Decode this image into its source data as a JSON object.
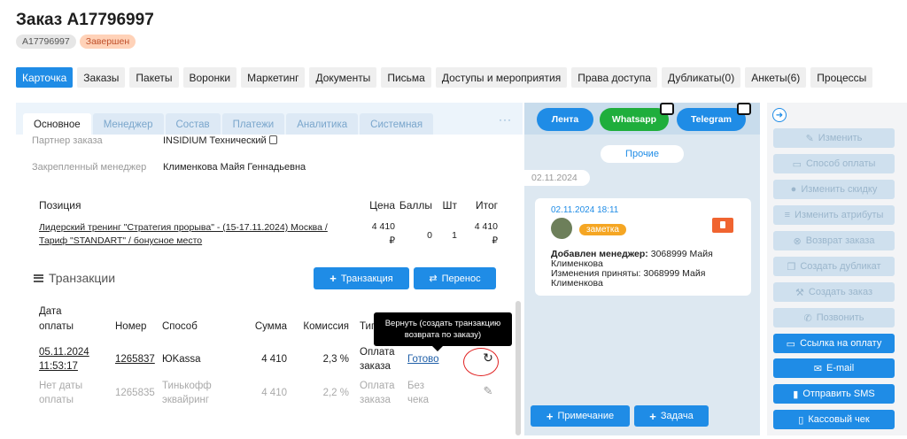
{
  "order": {
    "title": "Заказ A17796997",
    "id_badge": "A17796997",
    "status_badge": "Завершен"
  },
  "main_tabs": [
    "Карточка",
    "Заказы",
    "Пакеты",
    "Воронки",
    "Маркетинг",
    "Документы",
    "Письма",
    "Доступы и мероприятия",
    "Права доступа",
    "Дубликаты(0)",
    "Анкеты(6)",
    "Процессы"
  ],
  "sub_tabs": [
    "Основное",
    "Менеджер",
    "Состав",
    "Платежи",
    "Аналитика",
    "Системная"
  ],
  "sub_tabs_more": "···",
  "info": {
    "partner_label": "Партнер заказа",
    "partner_value": "INSIDIUM Технический",
    "manager_label": "Закрепленный менеджер",
    "manager_value": "Клименкова Майя Геннадьевна"
  },
  "positions": {
    "headers": {
      "name": "Позиция",
      "price": "Цена",
      "points": "Баллы",
      "qty": "Шт",
      "total": "Итог"
    },
    "rows": [
      {
        "name_line1": "Лидерский тренинг \"Стратегия прорыва\" - (15-17.11.2024) Москва /",
        "name_line2": "Тариф \"STANDART\" / бонусное место",
        "price_1": "4 410",
        "price_2": "₽",
        "points": "0",
        "qty": "1",
        "total_1": "4 410",
        "total_2": "₽"
      }
    ]
  },
  "transactions": {
    "title": "Транзакции",
    "add_button": "Транзакция",
    "transfer_button": "Перенос",
    "headers": {
      "date_1": "Дата",
      "date_2": "оплаты",
      "number": "Номер",
      "method": "Способ",
      "sum": "Сумма",
      "fee": "Комиссия",
      "type": "Тип"
    },
    "rows": [
      {
        "date_1": "05.11.2024",
        "date_2": "11:53:17",
        "number": "1265837",
        "method_1": "ЮKassa",
        "method_2": "",
        "sum": "4 410",
        "fee": "2,3 %",
        "type_1": "Оплата",
        "type_2": "заказа",
        "status_1": "Готово",
        "status_2": ""
      },
      {
        "date_1": "Нет даты",
        "date_2": "оплаты",
        "number": "1265835",
        "method_1": "Тинькофф",
        "method_2": "эквайринг",
        "sum": "4 410",
        "fee": "2,2 %",
        "type_1": "Оплата",
        "type_2": "заказа",
        "status_1": "Без",
        "status_2": "чека"
      }
    ],
    "tooltip": "Вернуть (создать транзакцию возврата по заказу)"
  },
  "feed": {
    "channels": [
      "Лента",
      "Whatsapp",
      "Telegram"
    ],
    "channel_colors": [
      "#1f8ce6",
      "#1fae3c",
      "#1f8ce6"
    ],
    "other": "Прочие",
    "date": "02.11.2024",
    "note": {
      "time": "02.11.2024 18:11",
      "tag": "заметка",
      "bold": "Добавлен менеджер:",
      "line1": " 3068999 Майя Клименкова",
      "line2": "Изменения приняты: 3068999 Майя Клименкова"
    },
    "note_button": "Примечание",
    "task_button": "Задача"
  },
  "actions": {
    "disabled": [
      "Изменить",
      "Способ оплаты",
      "Изменить скидку",
      "Изменить атрибуты",
      "Возврат заказа",
      "Создать дубликат",
      "Создать заказ",
      "Позвонить"
    ],
    "enabled": [
      "Ссылка на оплату",
      "E-mail",
      "Отправить SMS",
      "Кассовый чек"
    ]
  },
  "colors": {
    "accent": "#1f8ce6",
    "status_orange": "#ffd2b8",
    "tag_orange": "#f5a623"
  }
}
